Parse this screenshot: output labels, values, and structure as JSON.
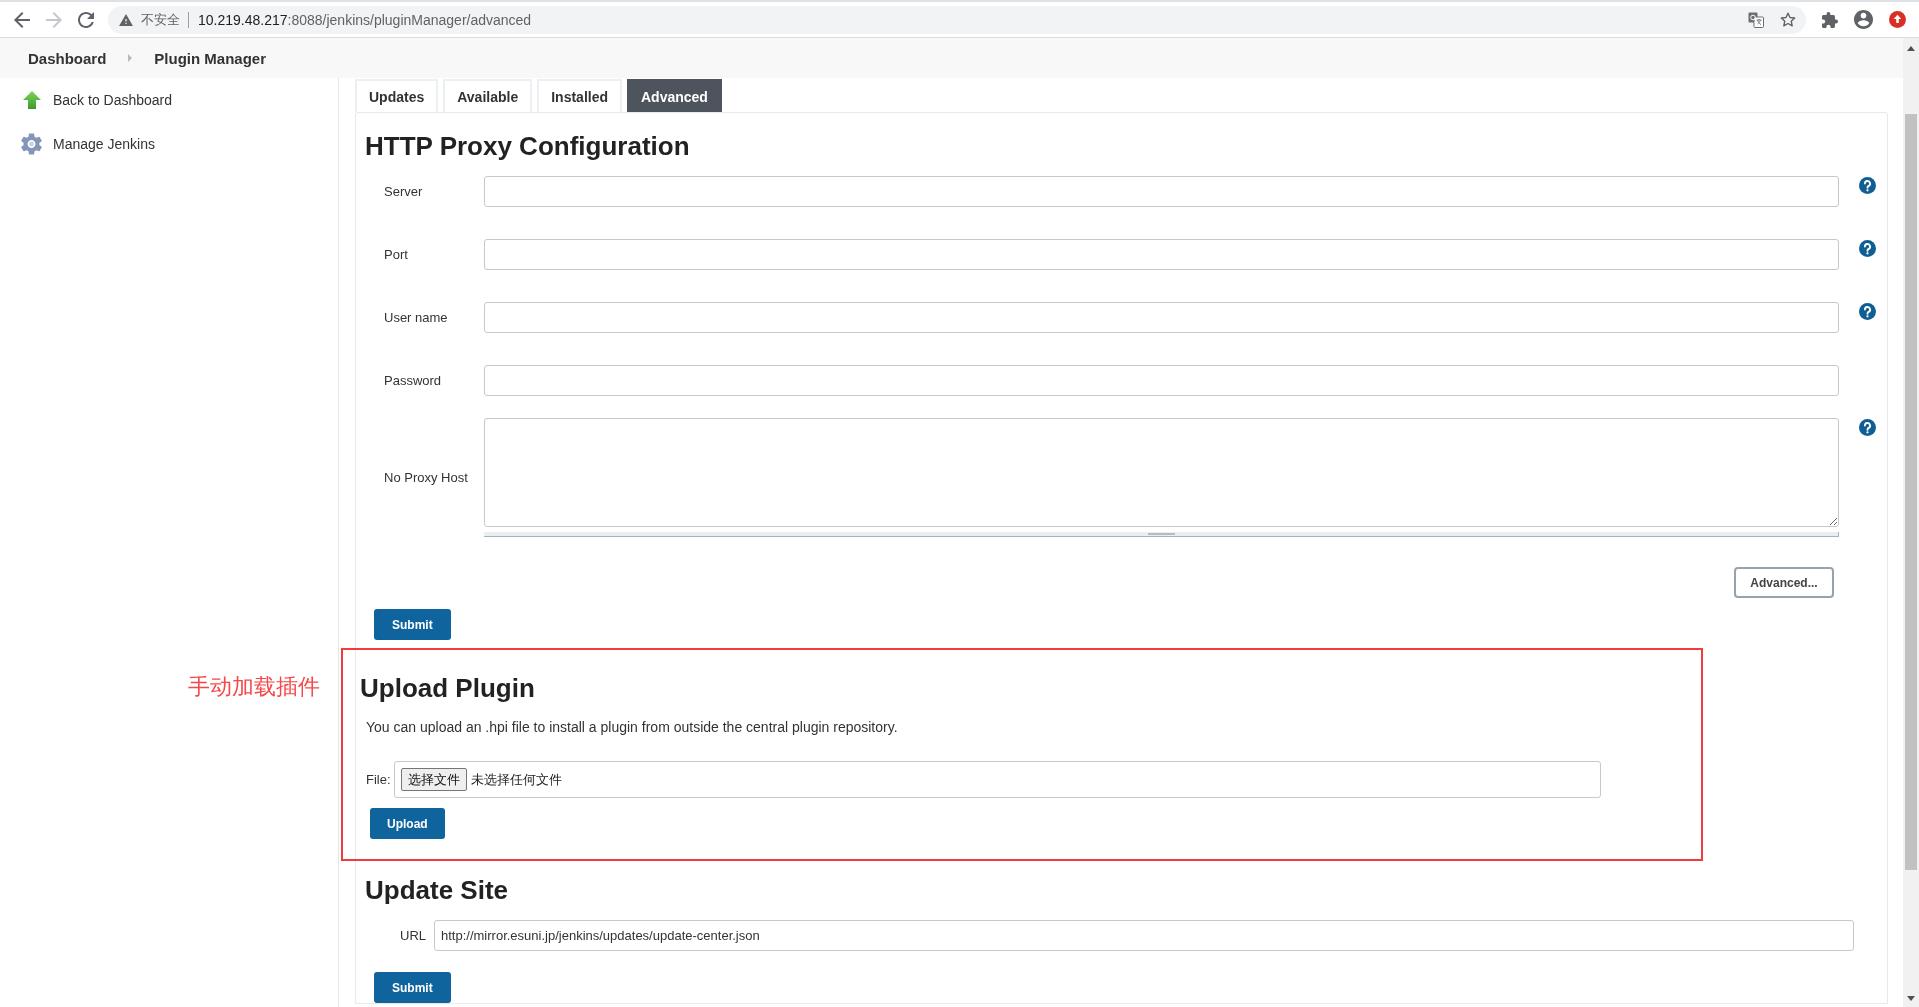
{
  "browser": {
    "forward_button": {
      "disabled": true
    },
    "security_label": "不安全",
    "url_host": "10.219.48.217",
    "url_rest": ":8088/jenkins/pluginManager/advanced"
  },
  "breadcrumbs": [
    {
      "label": "Dashboard"
    },
    {
      "label": "Plugin Manager"
    }
  ],
  "sidebar": {
    "items": [
      {
        "label": "Back to Dashboard"
      },
      {
        "label": "Manage Jenkins"
      }
    ]
  },
  "tabs": [
    {
      "label": "Updates",
      "selected": false
    },
    {
      "label": "Available",
      "selected": false
    },
    {
      "label": "Installed",
      "selected": false
    },
    {
      "label": "Advanced",
      "selected": true
    }
  ],
  "proxy": {
    "title": "HTTP Proxy Configuration",
    "fields": [
      {
        "label": "Server",
        "kind": "input",
        "help": true
      },
      {
        "label": "Port",
        "kind": "input",
        "help": true
      },
      {
        "label": "User name",
        "kind": "input",
        "help": true
      },
      {
        "label": "Password",
        "kind": "input",
        "help": false
      },
      {
        "label": "No Proxy Host",
        "kind": "textarea",
        "help": true
      }
    ],
    "advanced_button": "Advanced...",
    "submit_button": "Submit"
  },
  "annotation": {
    "text": "手动加载插件"
  },
  "upload": {
    "title": "Upload Plugin",
    "description": "You can upload an .hpi file to install a plugin from outside the central plugin repository.",
    "file_label": "File:",
    "file_button": "选择文件",
    "file_status": "未选择任何文件",
    "upload_button": "Upload"
  },
  "update_site": {
    "title": "Update Site",
    "url_label": "URL",
    "url_value": "http://mirror.esuni.jp/jenkins/updates/update-center.json",
    "submit_button": "Submit"
  }
}
